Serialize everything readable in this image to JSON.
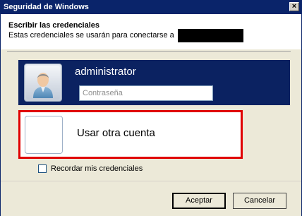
{
  "window": {
    "title": "Seguridad de Windows",
    "close_glyph": "×"
  },
  "header": {
    "title": "Escribir las credenciales",
    "subtitle": "Estas credenciales se usarán para conectarse a"
  },
  "selected_tile": {
    "username": "administrator",
    "password_placeholder": "Contraseña",
    "avatar_icon": "user-avatar-icon"
  },
  "other_account": {
    "label": "Usar otra cuenta",
    "avatar_icon": "blank-avatar-icon",
    "highlight_color": "#e00000"
  },
  "remember": {
    "label": "Recordar mis credenciales",
    "checked": false
  },
  "buttons": {
    "ok": "Aceptar",
    "cancel": "Cancelar"
  },
  "colors": {
    "titlebar": "#0a246a",
    "tile_selected": "#0b2261",
    "dialog_bg": "#ece9d8"
  }
}
